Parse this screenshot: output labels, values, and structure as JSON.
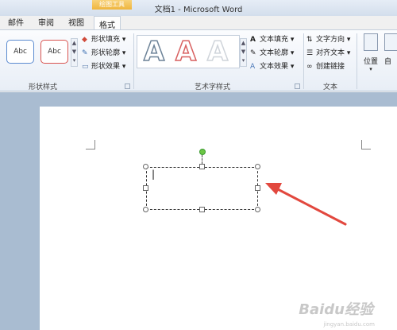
{
  "window": {
    "title": "文档1 - Microsoft Word",
    "context_header": "绘图工具"
  },
  "tabs": [
    "邮件",
    "审阅",
    "视图",
    "格式"
  ],
  "ribbon": {
    "shape_styles": {
      "label": "形状样式",
      "samples": [
        "Abc",
        "Abc"
      ],
      "commands": [
        "形状填充",
        "形状轮廓",
        "形状效果"
      ]
    },
    "wordart_styles": {
      "label": "艺术字样式",
      "commands": [
        "文本填充",
        "文本轮廓",
        "文本效果"
      ],
      "letter": "A"
    },
    "text": {
      "label": "文本",
      "commands": [
        "文字方向",
        "对齐文本",
        "创建链接"
      ]
    },
    "arrange": {
      "position": "位置",
      "wrap": "自"
    }
  },
  "document": {
    "textbox_cursor": "|"
  },
  "watermark": {
    "brand": "Baidu经验",
    "url": "jingyan.baidu.com"
  },
  "colors": {
    "accent": "#e2483e",
    "rotation_handle": "#6cc644",
    "context_tab": "#efb53d"
  }
}
